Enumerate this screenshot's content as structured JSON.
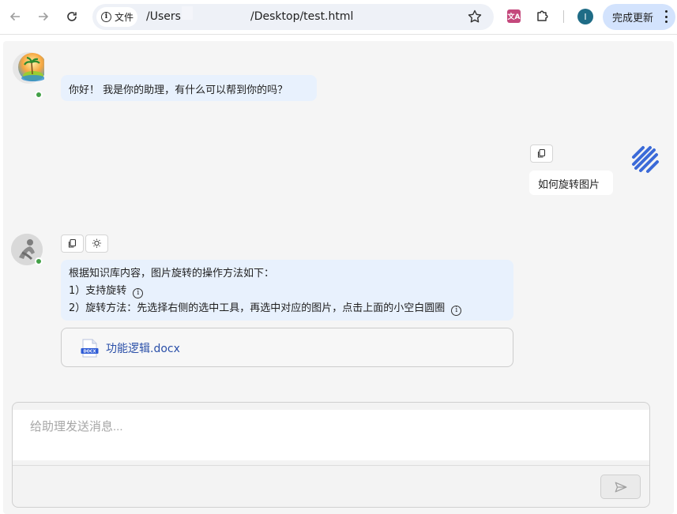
{
  "browser": {
    "chip_label": "文件",
    "url_left": "/Users",
    "url_right": "/Desktop/test.html",
    "update_label": "完成更新",
    "profile_initial": "I",
    "translate_glyph": "文A"
  },
  "chat": {
    "greeting": "你好！ 我是你的助理，有什么可以帮到你的吗？",
    "user_message": "如何旋转图片",
    "answer_intro": "根据知识库内容，图片旋转的操作方法如下：",
    "answer_item1": "1）支持旋转",
    "answer_item2": "2）旋转方法：先选择右侧的选中工具，再选中对应的图片，点击上面的小空白圆圈",
    "attachment_name": "功能逻辑.docx",
    "attachment_badge": "DOCX"
  },
  "composer": {
    "placeholder": "给助理发送消息..."
  },
  "colors": {
    "ai_bubble": "#e8f1fd",
    "online": "#43a047",
    "link": "#2a4fa8",
    "update_button": "#d3e3fd"
  }
}
